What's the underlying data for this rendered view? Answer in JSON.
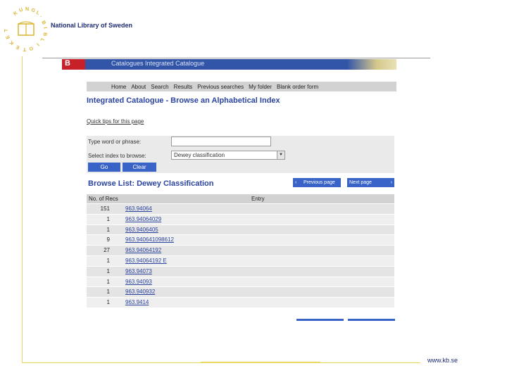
{
  "slide": {
    "org_name": "National Library of Sweden",
    "logo_text": "KUNGL. BIBLIOTEKET",
    "footer_url": "www.kb.se"
  },
  "banner": {
    "letter": "B",
    "title": "Catalogues Integrated Catalogue"
  },
  "nav": {
    "items": [
      "Home",
      "About",
      "Search",
      "Results",
      "Previous searches",
      "My folder",
      "Blank order form"
    ]
  },
  "page_title": "Integrated Catalogue - Browse an Alphabetical Index",
  "skip_link": "Quick tips for this page",
  "form": {
    "phrase_label": "Type word or phrase:",
    "phrase_value": "",
    "index_label": "Select index to browse:",
    "index_value": "Dewey classification",
    "go_label": "Go",
    "clear_label": "Clear"
  },
  "list_title": "Browse List: Dewey Classification",
  "pager": {
    "prev_label": "Previous page",
    "next_label": "Next page"
  },
  "table": {
    "headers": [
      "No. of Recs",
      "Entry"
    ],
    "rows": [
      {
        "recs": "151",
        "entry": "963.94064"
      },
      {
        "recs": "1",
        "entry": "963.94064029"
      },
      {
        "recs": "1",
        "entry": "963.9406405"
      },
      {
        "recs": "9",
        "entry": "963.940641098612"
      },
      {
        "recs": "27",
        "entry": "963.94064192"
      },
      {
        "recs": "1",
        "entry": "963.94064192 E"
      },
      {
        "recs": "1",
        "entry": "963.94073"
      },
      {
        "recs": "1",
        "entry": "963.94093"
      },
      {
        "recs": "1",
        "entry": "963.940932"
      },
      {
        "recs": "1",
        "entry": "963.9414"
      }
    ]
  }
}
